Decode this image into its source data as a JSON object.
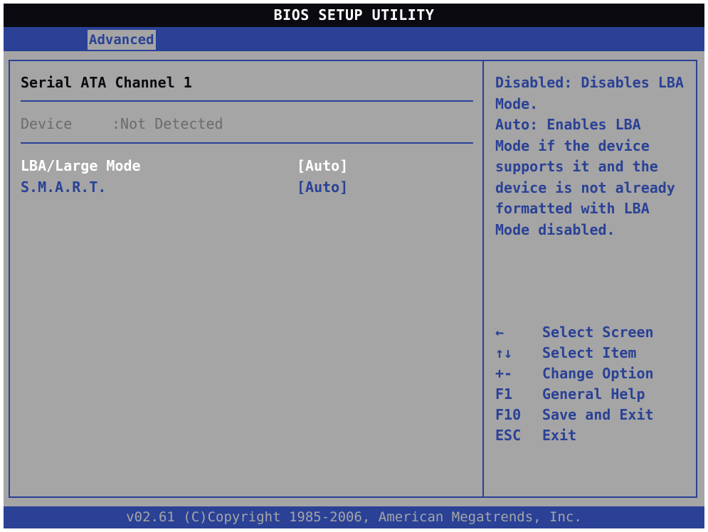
{
  "title": "BIOS SETUP UTILITY",
  "menu": {
    "active_tab": "Advanced"
  },
  "section": {
    "title": "Serial ATA Channel 1",
    "device_label": "Device",
    "device_value": ":Not Detected"
  },
  "options": [
    {
      "label": "LBA/Large Mode",
      "value": "[Auto]",
      "selected": true
    },
    {
      "label": "S.M.A.R.T.",
      "value": "[Auto]",
      "selected": false
    }
  ],
  "help": {
    "text": "Disabled: Disables LBA\nMode.\nAuto: Enables LBA\nMode if the device\nsupports it and the\ndevice is not already\nformatted with LBA\nMode disabled."
  },
  "keys": [
    {
      "key": "←",
      "action": "Select Screen"
    },
    {
      "key": "↑↓",
      "action": "Select Item"
    },
    {
      "key": "+-",
      "action": "Change Option"
    },
    {
      "key": "F1",
      "action": "General Help"
    },
    {
      "key": "F10",
      "action": "Save and Exit"
    },
    {
      "key": "ESC",
      "action": "Exit"
    }
  ],
  "footer": "v02.61 (C)Copyright 1985-2006, American Megatrends, Inc.",
  "colors": {
    "background": "#a5a5a5",
    "accent_blue": "#2a4196",
    "title_bar": "#0a0a10",
    "selected_text": "#ffffff",
    "disabled_text": "#6b6b6b"
  }
}
